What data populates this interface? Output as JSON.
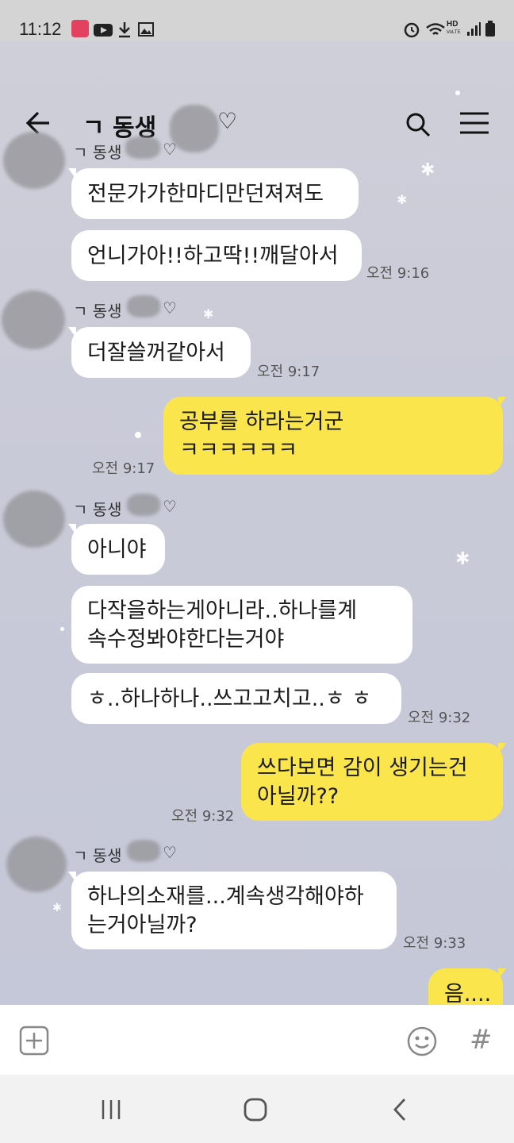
{
  "status_bar": {
    "time": "11:12",
    "hd_label": "HD",
    "voice_label": "VoLTE"
  },
  "header": {
    "title": "ㄱ 동생",
    "heart": "♡"
  },
  "messages": [
    {
      "sender": "ㄱ 동생",
      "heart": "♡",
      "bubbles": [
        "전문가가한마디만던져져도",
        "언니가아!!하고딱!!깨달아서"
      ],
      "time": "오전 9:16"
    },
    {
      "sender": "ㄱ 동생",
      "heart": "♡",
      "bubbles": [
        "더잘쓸꺼같아서"
      ],
      "time": "오전 9:17"
    },
    {
      "me": true,
      "lines": [
        "공부를 하라는거군",
        "ㅋㅋㅋㅋㅋㅋ"
      ],
      "time": "오전 9:17"
    },
    {
      "sender": "ㄱ 동생",
      "heart": "♡",
      "bubbles": [
        "아니야",
        "다작을하는게아니라..하나를계",
        "속수정봐야한다는거야",
        "ㅎ..하나하나..쓰고고치고..ㅎ ㅎ"
      ],
      "time": "오전 9:32"
    },
    {
      "me": true,
      "lines": [
        "쓰다보면 감이 생기는건",
        "아닐까??"
      ],
      "time": "오전 9:32"
    },
    {
      "sender": "ㄱ 동생",
      "heart": "♡",
      "bubbles": [
        "하나의소재를...계속생각해야하",
        "는거아닐까?"
      ],
      "time": "오전 9:33"
    },
    {
      "me": true,
      "lines": [
        "음...."
      ]
    }
  ],
  "input_bar": {
    "hash": "#"
  },
  "colors": {
    "my_bubble": "#fbe54d",
    "their_bubble": "#ffffff",
    "background": "#c9cad8"
  }
}
